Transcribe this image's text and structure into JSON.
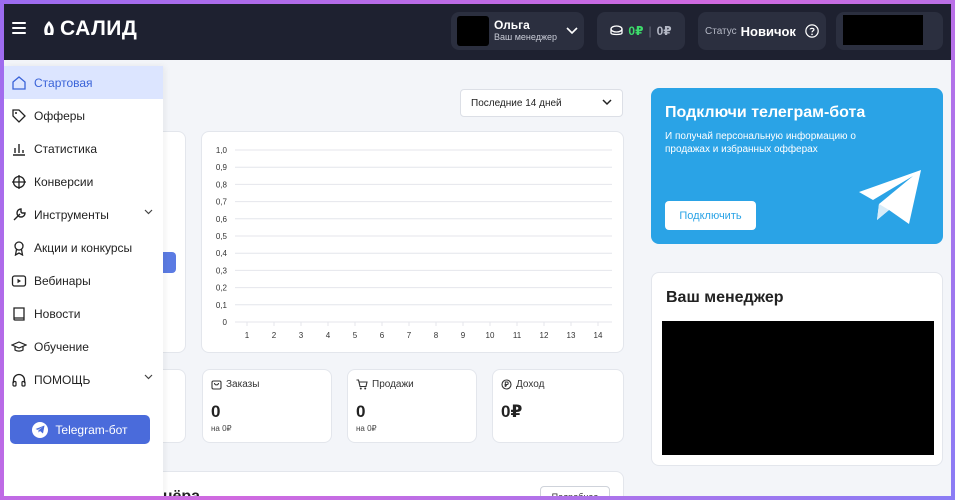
{
  "header": {
    "logo_text": "САЛИД",
    "user": {
      "name": "Ольга",
      "role": "Ваш менеджер"
    },
    "balance": {
      "primary": "0₽",
      "secondary": "0₽"
    },
    "status": {
      "label": "Статус",
      "value": "Новичок"
    }
  },
  "sidebar": {
    "items": [
      {
        "label": "Стартовая",
        "icon": "home-icon",
        "active": true
      },
      {
        "label": "Офферы",
        "icon": "tag-icon"
      },
      {
        "label": "Статистика",
        "icon": "bar-chart-icon"
      },
      {
        "label": "Конверсии",
        "icon": "crosshair-icon"
      },
      {
        "label": "Инструменты",
        "icon": "wrench-icon",
        "expandable": true
      },
      {
        "label": "Акции и конкурсы",
        "icon": "award-icon"
      },
      {
        "label": "Вебинары",
        "icon": "play-icon"
      },
      {
        "label": "Новости",
        "icon": "book-icon"
      },
      {
        "label": "Обучение",
        "icon": "graduation-cap-icon"
      },
      {
        "label": "ПОМОЩЬ",
        "icon": "headphones-icon",
        "expandable": true
      }
    ],
    "telegram_button": "Telegram-бот"
  },
  "period": {
    "selected": "Последние 14 дней"
  },
  "chart_data": {
    "type": "line",
    "x": [
      1,
      2,
      3,
      4,
      5,
      6,
      7,
      8,
      9,
      10,
      11,
      12,
      13,
      14
    ],
    "y_ticks": [
      "1,0",
      "0,9",
      "0,8",
      "0,7",
      "0,6",
      "0,5",
      "0,4",
      "0,3",
      "0,2",
      "0,1",
      "0"
    ],
    "ylim": [
      0,
      1
    ],
    "series": [],
    "grid": true
  },
  "stats": [
    {
      "title": "Заказы",
      "icon": "bag-icon",
      "value": "0",
      "sub": "на 0₽"
    },
    {
      "title": "Продажи",
      "icon": "cart-icon",
      "value": "0",
      "sub": "на 0₽"
    },
    {
      "title": "Доход",
      "icon": "coin-icon",
      "value": "0₽",
      "sub": ""
    }
  ],
  "bottom": {
    "title_fragment": "тнёра",
    "more_label": "Подробнее"
  },
  "telegram_card": {
    "title": "Подключи телеграм-бота",
    "description": "И получай персональную информацию о продажах и избранных офферах",
    "button": "Подключить"
  },
  "manager_card": {
    "title": "Ваш менеджер"
  },
  "colors": {
    "header_bg": "#1e2130",
    "accent": "#4a6bdb",
    "telegram": "#2aa3e6",
    "active_nav_bg": "#dce5ff",
    "positive": "#3ddc6b"
  }
}
